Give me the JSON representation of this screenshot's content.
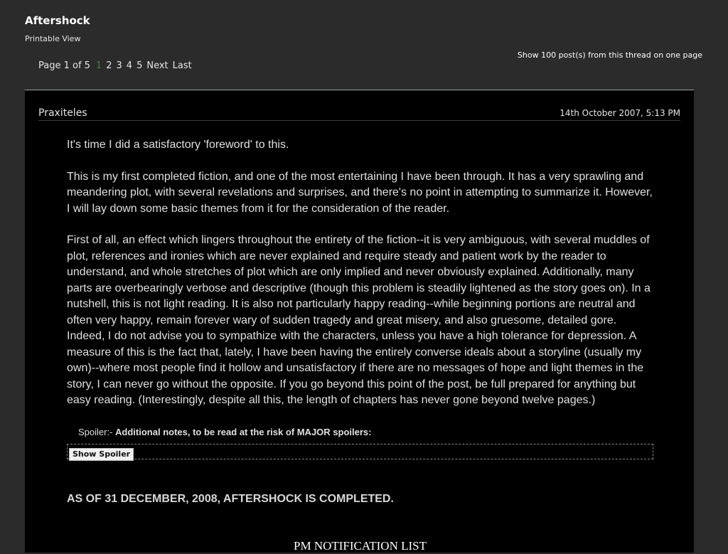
{
  "thread": {
    "title": "Aftershock",
    "printable_label": "Printable View",
    "show_all_link": "Show 100 post(s) from this thread on one page"
  },
  "pagination": {
    "label": "Page 1 of 5",
    "current": "1",
    "pages": [
      "2",
      "3",
      "4",
      "5"
    ],
    "next": "Next",
    "last": "Last"
  },
  "post": {
    "author": "Praxiteles",
    "date": "14th October 2007, 5:13 PM",
    "paragraphs": [
      "It's time I did a satisfactory 'foreword' to this.",
      "This is my first completed fiction, and one of the most entertaining I have been through. It has a very sprawling and meandering plot, with several revelations and surprises, and there's no point in attempting to summarize it. However, I will lay down some basic themes from it for the consideration of the reader.",
      "First of all, an effect which lingers throughout the entirety of the fiction--it is very ambiguous, with several muddles of plot, references and ironies which are never explained and require steady and patient work by the reader to understand, and whole stretches of plot which are only implied and never obviously explained. Additionally, many parts are overbearingly verbose and descriptive (though this problem is steadily lightened as the story goes on). In a nutshell, this is not light reading. It is also not particularly happy reading--while beginning portions are neutral and often very happy, remain forever wary of sudden tragedy and great misery, and also gruesome, detailed gore. Indeed, I do not advise you to sympathize with the characters, unless you have a high tolerance for depression. A measure of this is the fact that, lately, I have been having the entirely converse ideals about a storyline (usually my own)--where most people find it hollow and unsatisfactory if there are no messages of hope and light themes in the story, I can never go without the opposite. If you go beyond this point of the post, be full prepared for anything but easy reading. (Interestingly, despite all this, the length of chapters has never gone beyond twelve pages.)"
    ],
    "spoiler": {
      "prefix": "Spoiler:- ",
      "title": "Additional notes, to be read at the risk of MAJOR spoilers:",
      "button": "Show Spoiler"
    },
    "completed_notice": "AS OF 31 DECEMBER, 2008, AFTERSHOCK IS COMPLETED.",
    "pm_heading": "PM NOTIFICATION LIST"
  },
  "colors": {
    "page_bg": "#2b2b2b",
    "post_bg": "#000000",
    "current_page": "#2e8b2e"
  }
}
